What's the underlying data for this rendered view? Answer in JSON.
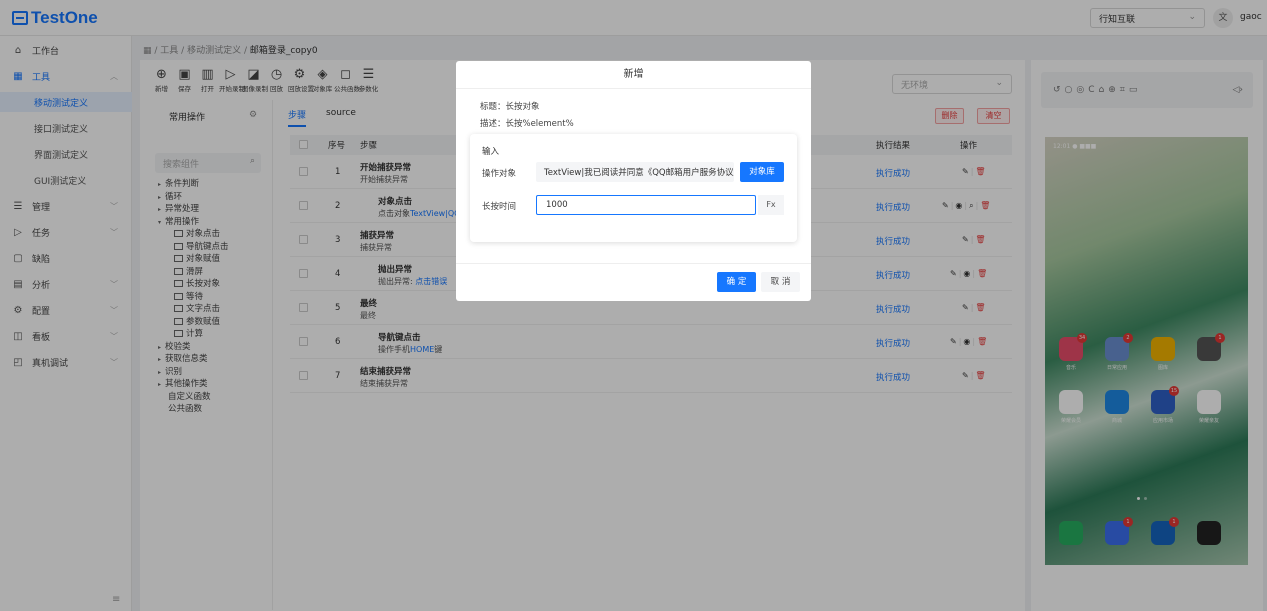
{
  "app": {
    "name": "TestOne"
  },
  "header": {
    "org": "行知互联",
    "lang": "文",
    "user": "gaoc"
  },
  "sidebar": {
    "items": [
      {
        "label": "工作台",
        "icon": "home-icon"
      },
      {
        "label": "工具",
        "icon": "grid-icon"
      },
      {
        "label": "管理",
        "icon": "list-icon"
      },
      {
        "label": "任务",
        "icon": "play-icon"
      },
      {
        "label": "缺陷",
        "icon": "doc-icon"
      },
      {
        "label": "分析",
        "icon": "calendar-icon"
      },
      {
        "label": "配置",
        "icon": "gear-icon"
      },
      {
        "label": "看板",
        "icon": "board-icon"
      },
      {
        "label": "真机调试",
        "icon": "phone-icon"
      }
    ],
    "sub": [
      "移动测试定义",
      "接口测试定义",
      "界面测试定义",
      "GUI测试定义"
    ]
  },
  "breadcrumb": {
    "root": "工具",
    "mid": "移动测试定义",
    "current": "邮箱登录_copy0"
  },
  "toolbar": [
    "新增",
    "保存",
    "打开",
    "开始录制",
    "图像录制",
    "回放",
    "回放设置",
    "对象库",
    "公共函数",
    "参数化"
  ],
  "env": {
    "placeholder": "无环境"
  },
  "leftpanel": {
    "title": "常用操作",
    "search_placeholder": "搜索组件",
    "tree": {
      "groups_before": [
        "条件判断",
        "循环",
        "异常处理"
      ],
      "open_group": "常用操作",
      "leaves": [
        "对象点击",
        "导航键点击",
        "对象赋值",
        "滑屏",
        "长按对象",
        "等待",
        "文字点击",
        "参数赋值",
        "计算"
      ],
      "groups_after": [
        "校验类",
        "获取信息类",
        "识别",
        "其他操作类"
      ],
      "plain": [
        "自定义函数",
        "公共函数"
      ]
    }
  },
  "tabs": [
    "步骤",
    "source"
  ],
  "actions": {
    "delete": "删除",
    "clear": "清空"
  },
  "table": {
    "headers": {
      "idx": "序号",
      "step": "步骤",
      "result": "执行结果",
      "ops": "操作"
    },
    "rows": [
      {
        "idx": "1",
        "title": "开始捕获异常",
        "desc": "开始捕获异常",
        "link": "",
        "result": "执行成功",
        "indent": 0,
        "ops": "full"
      },
      {
        "idx": "2",
        "title": "对象点击",
        "desc": "点击对象",
        "link": "TextView|QQ",
        "result": "执行成功",
        "indent": 1,
        "ops": "ext"
      },
      {
        "idx": "3",
        "title": "捕获异常",
        "desc": "捕获异常",
        "link": "",
        "result": "执行成功",
        "indent": 0,
        "ops": "full"
      },
      {
        "idx": "4",
        "title": "抛出异常",
        "desc": "抛出异常: ",
        "link": "点击错误",
        "result": "执行成功",
        "indent": 1,
        "ops": "mid"
      },
      {
        "idx": "5",
        "title": "最终",
        "desc": "最终",
        "link": "",
        "result": "执行成功",
        "indent": 0,
        "ops": "full"
      },
      {
        "idx": "6",
        "title": "导航键点击",
        "desc": "操作手机",
        "link": "HOME",
        "suffix": "键",
        "result": "执行成功",
        "indent": 1,
        "ops": "mid"
      },
      {
        "idx": "7",
        "title": "结束捕获异常",
        "desc": "结束捕获异常",
        "link": "",
        "result": "执行成功",
        "indent": 0,
        "ops": "full"
      }
    ]
  },
  "device": {
    "toolbar_icons": "↺○◎C⌂⊕⌗▭",
    "volume": "◁›",
    "status": "12:01 ● ■■■",
    "apps": [
      {
        "label": "音乐",
        "badge": "34",
        "color": "#e94d6a"
      },
      {
        "label": "日常应用",
        "badge": "2",
        "color": "#6a8fd1"
      },
      {
        "label": "图库",
        "badge": "",
        "color": "#f4b400"
      },
      {
        "label": "",
        "badge": "1",
        "color": "#555555"
      },
      {
        "label": "荣耀会员",
        "badge": "",
        "color": "#ffffff"
      },
      {
        "label": "商城",
        "badge": "",
        "color": "#1e88e5"
      },
      {
        "label": "应用市场",
        "badge": "15",
        "color": "#2e60c8"
      },
      {
        "label": "荣耀亲友",
        "badge": "",
        "color": "#ffffff"
      }
    ],
    "dock": [
      {
        "badge": "",
        "color": "#27ae60"
      },
      {
        "badge": "1",
        "color": "#3b6ff0"
      },
      {
        "badge": "1",
        "color": "#1565c0"
      },
      {
        "badge": "",
        "color": "#222222"
      }
    ]
  },
  "modal": {
    "title": "新增",
    "heading_line": "标题：长按对象",
    "desc_line": "描述：长按%element%",
    "section": "输入",
    "obj_label": "操作对象",
    "obj_value": "TextView|我已阅读并同意《QQ邮箱用户服务协议",
    "obj_button": "对象库",
    "dur_label": "长按时间",
    "dur_value": "1000",
    "fx": "Fx",
    "ok": "确 定",
    "cancel": "取 消"
  }
}
